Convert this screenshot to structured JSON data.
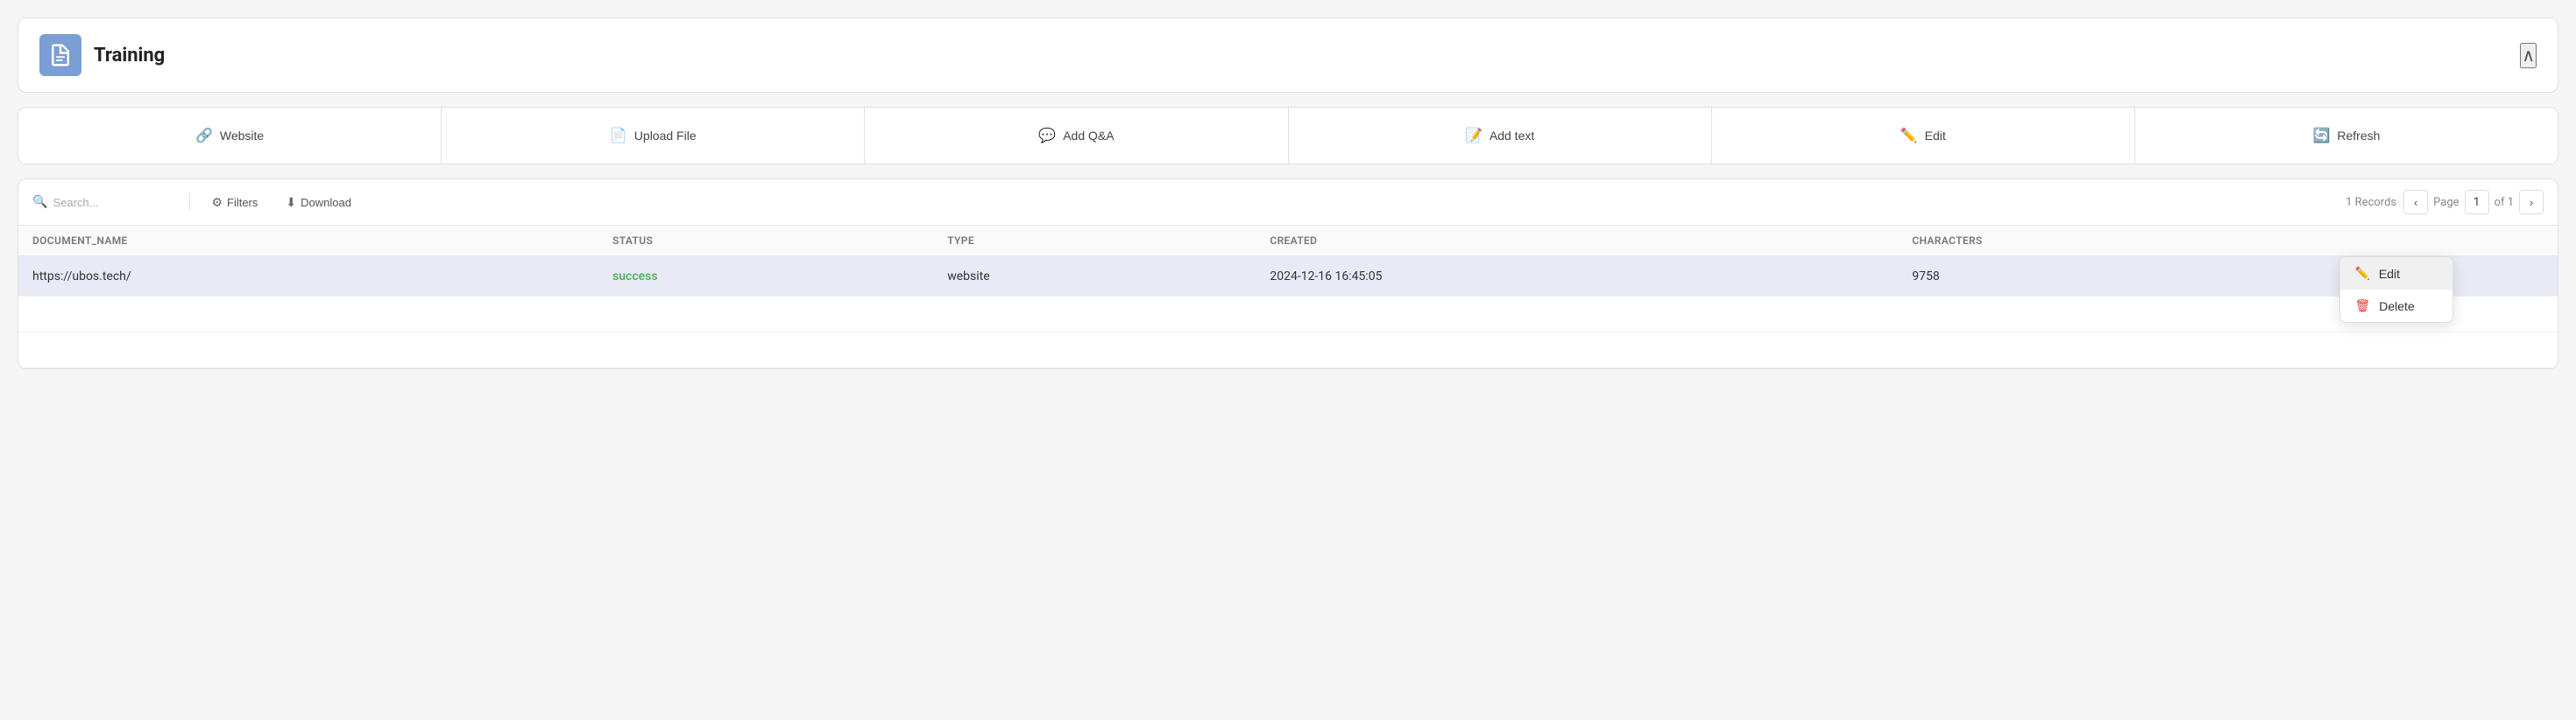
{
  "header": {
    "title": "Training",
    "chevron": "^",
    "icon_label": "document-icon"
  },
  "toolbar": {
    "buttons": [
      {
        "id": "website",
        "label": "Website",
        "icon": "🔗"
      },
      {
        "id": "upload-file",
        "label": "Upload File",
        "icon": "📄"
      },
      {
        "id": "add-qa",
        "label": "Add Q&A",
        "icon": "💬"
      },
      {
        "id": "add-text",
        "label": "Add text",
        "icon": "📝"
      },
      {
        "id": "edit",
        "label": "Edit",
        "icon": "✏️"
      },
      {
        "id": "refresh",
        "label": "Refresh",
        "icon": "🔄"
      }
    ]
  },
  "controls": {
    "search_placeholder": "Search...",
    "filters_label": "Filters",
    "download_label": "Download",
    "records_count": "1 Records",
    "page_label": "Page",
    "page_current": "1",
    "page_total": "of 1"
  },
  "table": {
    "columns": [
      "DOCUMENT_NAME",
      "STATUS",
      "TYPE",
      "CREATED",
      "CHARACTERS",
      ""
    ],
    "rows": [
      {
        "document_name": "https://ubos.tech/",
        "status": "success",
        "type": "website",
        "created": "2024-12-16 16:45:05",
        "characters": "9758"
      }
    ]
  },
  "dropdown": {
    "items": [
      {
        "id": "edit",
        "label": "Edit",
        "icon": "edit"
      },
      {
        "id": "delete",
        "label": "Delete",
        "icon": "delete"
      }
    ]
  },
  "colors": {
    "success": "#4caf50",
    "accent": "#5b8dd9",
    "selected_row_bg": "#e8eaf6"
  }
}
